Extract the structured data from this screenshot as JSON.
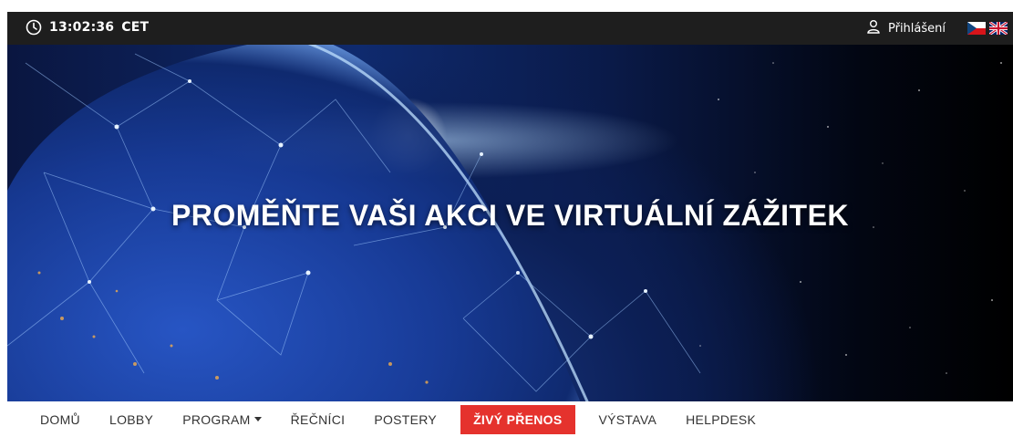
{
  "topbar": {
    "time": "13:02:36",
    "timezone": "CET",
    "login_label": "Přihlášení",
    "icons": {
      "clock": "clock-icon",
      "user": "user-icon",
      "flag_cz": "flag-cz-icon",
      "flag_uk": "flag-uk-icon"
    }
  },
  "hero": {
    "title": "PROMĚŇTE VAŠI AKCI VE VIRTUÁLNÍ ZÁŽITEK"
  },
  "nav": {
    "items": [
      {
        "label": "DOMŮ"
      },
      {
        "label": "LOBBY"
      },
      {
        "label": "PROGRAM"
      },
      {
        "label": "ŘEČNÍCI"
      },
      {
        "label": "POSTERY"
      },
      {
        "label": "ŽIVÝ PŘENOS"
      },
      {
        "label": "VÝSTAVA"
      },
      {
        "label": "HELPDESK"
      }
    ]
  },
  "colors": {
    "topbar_bg": "#1e1e1e",
    "live_highlight": "#e5322d",
    "accent": "#f0a830"
  }
}
